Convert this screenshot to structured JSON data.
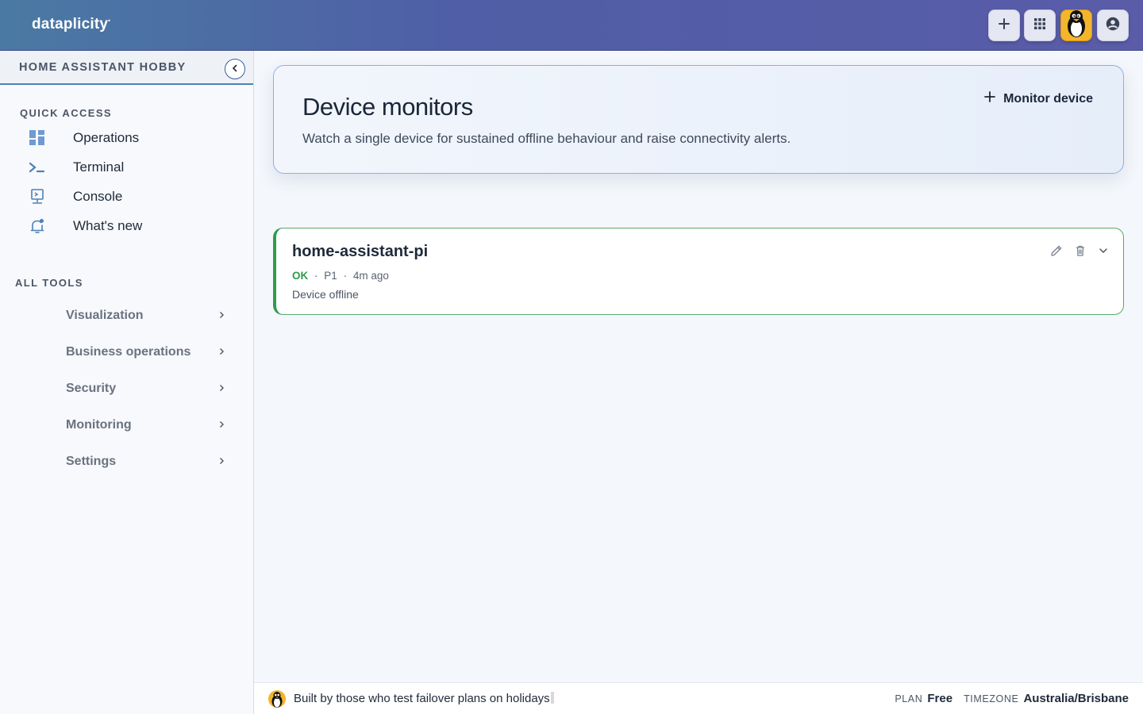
{
  "app": {
    "logo": "dataplicity",
    "logo_mark": "•"
  },
  "topbar": {
    "buttons": [
      {
        "name": "add",
        "icon": "plus-icon"
      },
      {
        "name": "apps",
        "icon": "grid-icon"
      },
      {
        "name": "avatar",
        "icon": "tux-avatar"
      },
      {
        "name": "account",
        "icon": "user-circle-icon"
      }
    ]
  },
  "sidebar": {
    "workspace": "HOME ASSISTANT HOBBY",
    "quick_access_label": "QUICK ACCESS",
    "quick_access": [
      {
        "label": "Operations",
        "icon": "dashboard-icon"
      },
      {
        "label": "Terminal",
        "icon": "terminal-icon"
      },
      {
        "label": "Console",
        "icon": "console-icon"
      },
      {
        "label": "What's new",
        "icon": "bell-icon"
      }
    ],
    "all_tools_label": "ALL TOOLS",
    "tools": [
      {
        "label": "Visualization"
      },
      {
        "label": "Business operations"
      },
      {
        "label": "Security"
      },
      {
        "label": "Monitoring"
      },
      {
        "label": "Settings"
      }
    ]
  },
  "main": {
    "title": "Device monitors",
    "subtitle": "Watch a single device for sustained offline behaviour and raise connectivity alerts.",
    "action_label": "Monitor device",
    "monitors": [
      {
        "name": "home-assistant-pi",
        "status": "OK",
        "priority": "P1",
        "age": "4m ago",
        "description": "Device offline",
        "sep": "·"
      }
    ]
  },
  "footer": {
    "tagline": "Built by those who test failover plans on holidays",
    "plan_label": "PLAN",
    "plan_value": "Free",
    "timezone_label": "TIMEZONE",
    "timezone_value": "Australia/Brisbane"
  },
  "colors": {
    "accent": "#4f7fb8",
    "ok": "#2f9c4a",
    "avatar_bg": "#f3b52c"
  }
}
